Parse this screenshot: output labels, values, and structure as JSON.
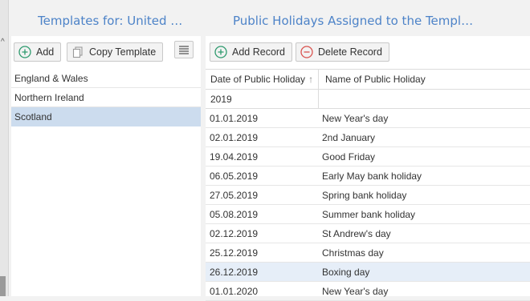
{
  "left_panel": {
    "title": "Templates for: United King...",
    "add_label": "Add",
    "copy_label": "Copy Template",
    "templates": [
      {
        "name": "England & Wales"
      },
      {
        "name": "Northern Ireland"
      },
      {
        "name": "Scotland",
        "selected": true
      }
    ]
  },
  "right_panel": {
    "title": "Public Holidays Assigned to the Template",
    "add_record_label": "Add Record",
    "delete_record_label": "Delete Record",
    "columns": {
      "date": "Date of Public Holiday",
      "name": "Name of Public Holiday"
    },
    "group_label": "2019",
    "rows": [
      {
        "date": "01.01.2019",
        "name": "New Year's day"
      },
      {
        "date": "02.01.2019",
        "name": "2nd January"
      },
      {
        "date": "19.04.2019",
        "name": "Good Friday"
      },
      {
        "date": "06.05.2019",
        "name": "Early May bank holiday"
      },
      {
        "date": "27.05.2019",
        "name": "Spring bank holiday"
      },
      {
        "date": "05.08.2019",
        "name": "Summer bank holiday"
      },
      {
        "date": "02.12.2019",
        "name": "St Andrew's day"
      },
      {
        "date": "25.12.2019",
        "name": "Christmas day"
      },
      {
        "date": "26.12.2019",
        "name": "Boxing day",
        "highlight": true
      },
      {
        "date": "01.01.2020",
        "name": "New Year's day"
      }
    ]
  },
  "colors": {
    "title": "#4d83c8",
    "selected_row": "#ccdcee",
    "highlight_row": "#e6eef8",
    "add_icon": "#2e9a6e",
    "delete_icon": "#d9534f"
  },
  "icons": {
    "add": "plus-circle-icon",
    "copy": "copy-icon",
    "menu": "hamburger-menu-icon",
    "delete": "minus-circle-icon",
    "sort": "sort-ascending-icon"
  }
}
